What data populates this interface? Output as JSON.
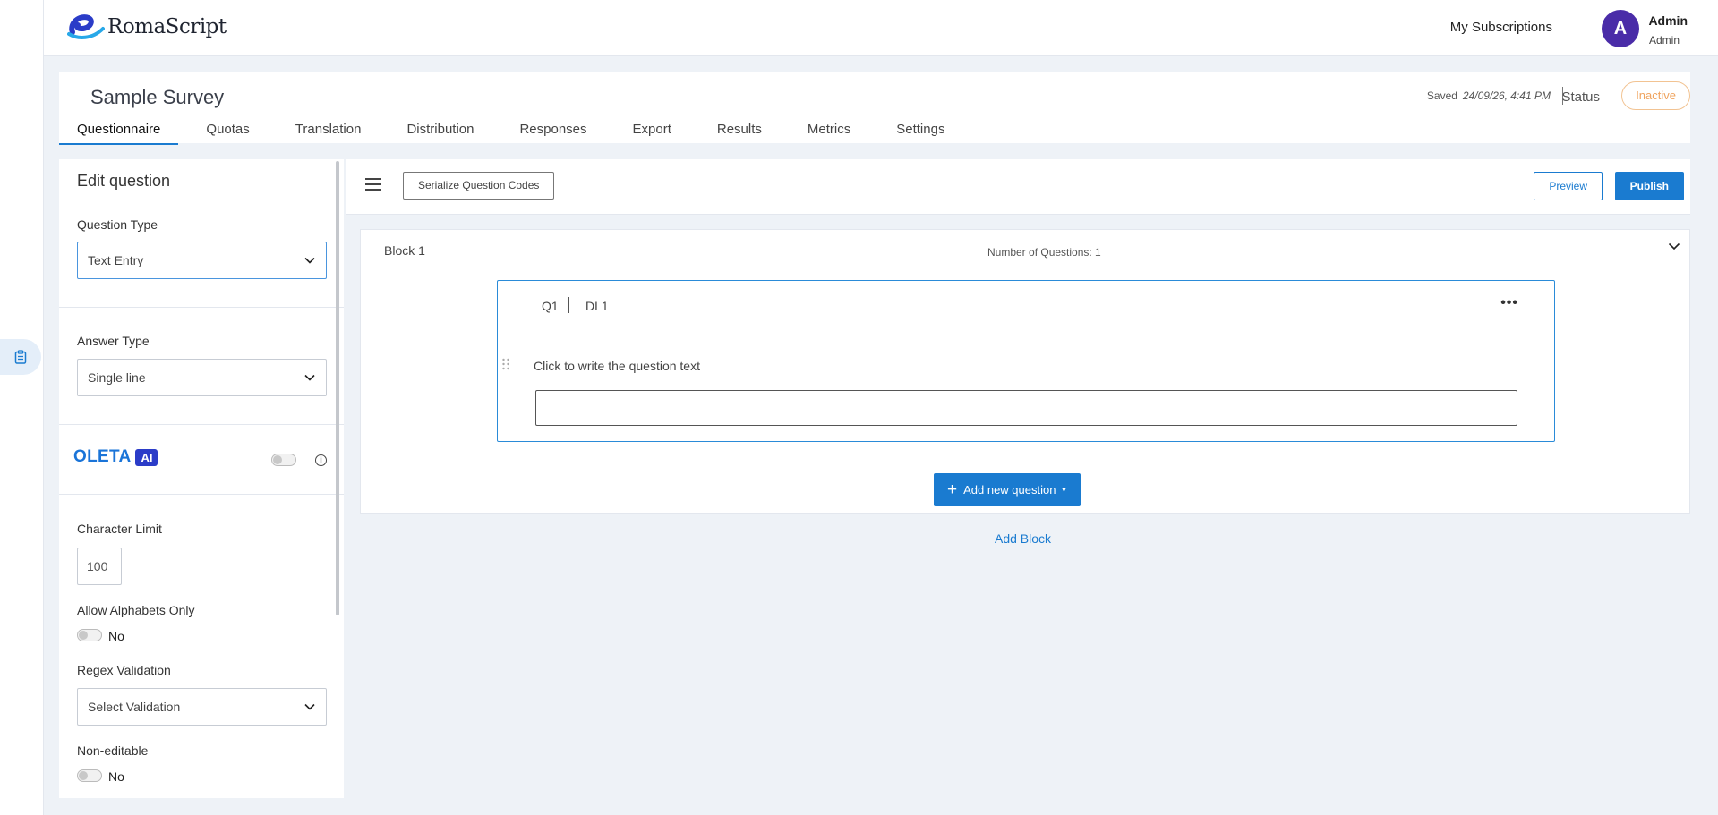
{
  "header": {
    "logo_text": "RomaScript",
    "subscriptions_link": "My Subscriptions",
    "user_initial": "A",
    "user_name": "Admin",
    "user_role": "Admin"
  },
  "survey": {
    "title": "Sample Survey",
    "saved_label": "Saved",
    "saved_time": "24/09/26, 4:41 PM",
    "status_label": "Status",
    "status_value": "Inactive",
    "status_color": "#f0a45f"
  },
  "tabs": [
    {
      "label": "Questionnaire",
      "active": true
    },
    {
      "label": "Quotas"
    },
    {
      "label": "Translation"
    },
    {
      "label": "Distribution"
    },
    {
      "label": "Responses"
    },
    {
      "label": "Export"
    },
    {
      "label": "Results"
    },
    {
      "label": "Metrics"
    },
    {
      "label": "Settings"
    }
  ],
  "edit_panel": {
    "title": "Edit question",
    "question_type_label": "Question Type",
    "question_type_value": "Text Entry",
    "answer_type_label": "Answer Type",
    "answer_type_value": "Single line",
    "oleta_text": "OLETA",
    "oleta_badge": "AI",
    "character_limit_label": "Character Limit",
    "character_limit_value": "100",
    "alphabets_only_label": "Allow Alphabets Only",
    "alphabets_only_value": "No",
    "regex_label": "Regex Validation",
    "regex_placeholder": "Select Validation",
    "non_editable_label": "Non-editable",
    "non_editable_value": "No"
  },
  "toolbar": {
    "serialize_label": "Serialize Question Codes",
    "preview_label": "Preview",
    "publish_label": "Publish"
  },
  "block": {
    "title": "Block 1",
    "count_label": "Number of Questions: 1",
    "question": {
      "id": "Q1",
      "code": "DL1",
      "text": "Click to write the question text"
    },
    "add_question_label": "Add new question"
  },
  "add_block_label": "Add Block",
  "colors": {
    "accent": "#1a7bd0",
    "avatar": "#4a2ca8",
    "oleta": "#1a74d8",
    "ai_badge": "#2b3cc8"
  }
}
